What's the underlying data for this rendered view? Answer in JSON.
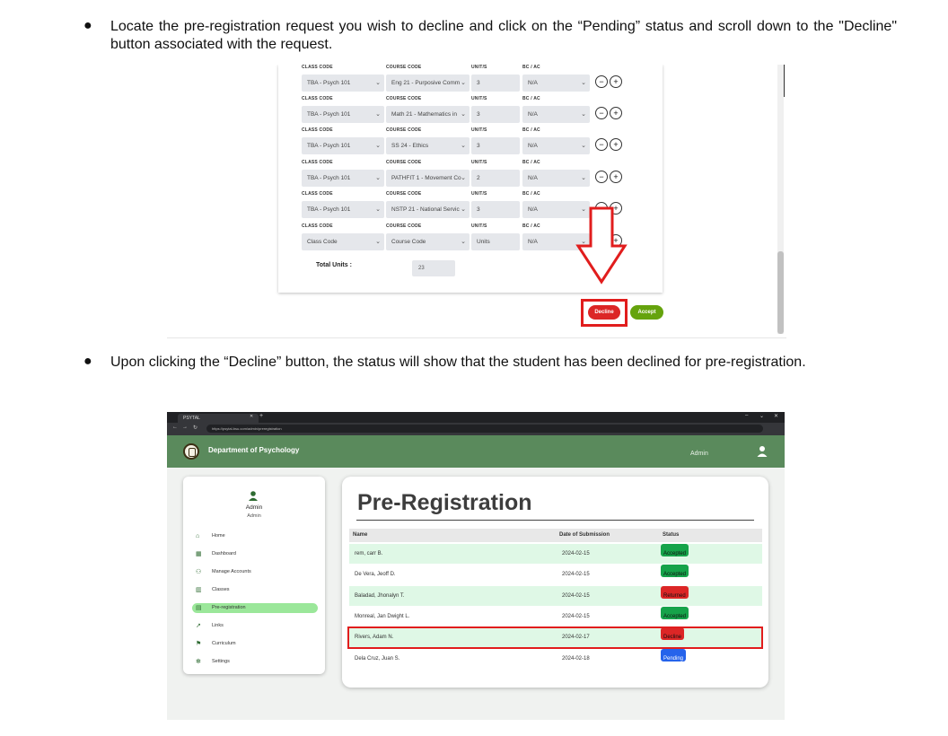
{
  "instructions": {
    "step1": "Locate the pre-registration request you wish to decline and click on the “Pending” status and scroll down to the \"Decline\" button associated with the request.",
    "step2": "Upon clicking the “Decline” button, the status will show that the student has been declined for pre-registration."
  },
  "form": {
    "labels": {
      "class_code": "CLASS CODE",
      "course_code": "COURSE CODE",
      "units": "UNIT/S",
      "bc_ac": "BC / AC"
    },
    "rows": [
      {
        "class_code": "TBA - Psych 101",
        "course_code": "Eng 21 - Purposive Comm",
        "units": "3",
        "bc_ac": "N/A"
      },
      {
        "class_code": "TBA - Psych 101",
        "course_code": "Math 21 - Mathematics in",
        "units": "3",
        "bc_ac": "N/A"
      },
      {
        "class_code": "TBA - Psych 101",
        "course_code": "SS 24 - Ethics",
        "units": "3",
        "bc_ac": "N/A"
      },
      {
        "class_code": "TBA - Psych 101",
        "course_code": "PATHFIT 1 - Movement Co",
        "units": "2",
        "bc_ac": "N/A"
      },
      {
        "class_code": "TBA - Psych 101",
        "course_code": "NSTP 21 - National Servic",
        "units": "3",
        "bc_ac": "N/A"
      },
      {
        "class_code": "Class Code",
        "course_code": "Course Code",
        "units": "Units",
        "bc_ac": "N/A"
      }
    ],
    "total_label": "Total Units :",
    "total_value": "23",
    "decline_label": "Decline",
    "accept_label": "Accept",
    "minus": "−",
    "plus": "+"
  },
  "browser": {
    "tab_title": "PSYTAL",
    "url": "https://psytal-bsu.com/admin/preregistration"
  },
  "app": {
    "department": "Department of Psychology",
    "top_user": "Admin",
    "sidebar": {
      "name": "Admin",
      "role": "Admin",
      "items": [
        {
          "label": "Home",
          "icon": "home-icon"
        },
        {
          "label": "Dashboard",
          "icon": "dashboard-icon"
        },
        {
          "label": "Manage Accounts",
          "icon": "manage-accounts-icon"
        },
        {
          "label": "Classes",
          "icon": "classes-icon"
        },
        {
          "label": "Pre-registration",
          "icon": "pre-registration-icon",
          "active": true
        },
        {
          "label": "Links",
          "icon": "links-icon"
        },
        {
          "label": "Curriculum",
          "icon": "curriculum-icon"
        },
        {
          "label": "Settings",
          "icon": "settings-icon"
        }
      ]
    },
    "page_title": "Pre-Registration",
    "table": {
      "headers": [
        "Name",
        "Date of Submission",
        "Status"
      ],
      "rows": [
        {
          "name": "rem, carr B.",
          "date": "2024-02-15",
          "status": "Accepted"
        },
        {
          "name": "De Vera, Jeoff D.",
          "date": "2024-02-15",
          "status": "Accepted"
        },
        {
          "name": "Baladad, Jhonalyn T.",
          "date": "2024-02-15",
          "status": "Returned"
        },
        {
          "name": "Monreal, Jan Dwight L.",
          "date": "2024-02-15",
          "status": "Accepted"
        },
        {
          "name": "Rivers, Adam N.",
          "date": "2024-02-17",
          "status": "Decline"
        },
        {
          "name": "Dela Cruz, Juan S.",
          "date": "2024-02-18",
          "status": "Pending"
        }
      ]
    },
    "colors": {
      "appbar": "#5a8a5c",
      "active_nav": "#9be79a",
      "highlight": "#e11d1d"
    }
  }
}
